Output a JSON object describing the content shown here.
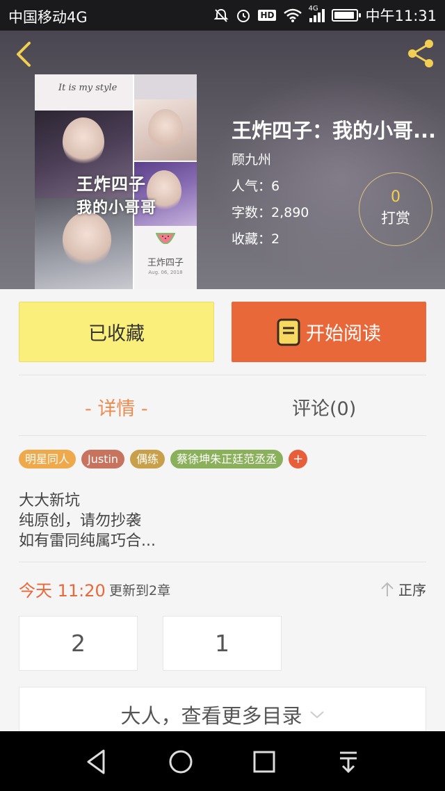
{
  "status_bar": {
    "carrier": "中国移动4G",
    "hd_badge": "HD",
    "network_type": "4G",
    "time": "中午11:31"
  },
  "header": {
    "back_icon": "chevron-left-icon",
    "share_icon": "share-icon",
    "accent_color": "#f2cf52"
  },
  "cover": {
    "tagline": "It is my style",
    "title_line1": "王炸四子",
    "title_line2": "我的小哥哥",
    "label": "王炸四子",
    "date": "Aug. 06, 2018"
  },
  "book": {
    "title": "王炸四子：我的小哥...",
    "author": "顾九州",
    "popularity": "人气：6",
    "word_count": "字数：2,890",
    "favorites": "收藏：2"
  },
  "tip": {
    "count": "0",
    "label": "打赏"
  },
  "actions": {
    "favorite_label": "已收藏",
    "read_label": "开始阅读",
    "favorite_color": "#fbef7c",
    "read_color": "#e9683a"
  },
  "tabs": [
    {
      "label": "- 详情 -",
      "active": true
    },
    {
      "label": "评论(0)",
      "active": false
    }
  ],
  "tags": [
    {
      "label": "明星同人",
      "color": "#f0a94a"
    },
    {
      "label": "Justin",
      "color": "#c8735e"
    },
    {
      "label": "偶练",
      "color": "#c9a04a"
    },
    {
      "label": "蔡徐坤朱正廷范丞丞",
      "color": "#8ab05c"
    }
  ],
  "add_tag": "+",
  "description": [
    "大大新坑",
    "纯原创，请勿抄袭",
    "如有雷同纯属巧合..."
  ],
  "update": {
    "time": "今天 11:20",
    "text": "更新到2章",
    "order_label": "正序"
  },
  "chapters": [
    "2",
    "1"
  ],
  "more_toc_label": "大人，查看更多目录",
  "nav_bar": {
    "back": "triangle-back-icon",
    "home": "circle-home-icon",
    "recents": "square-recents-icon",
    "notifications": "pulldown-icon"
  }
}
